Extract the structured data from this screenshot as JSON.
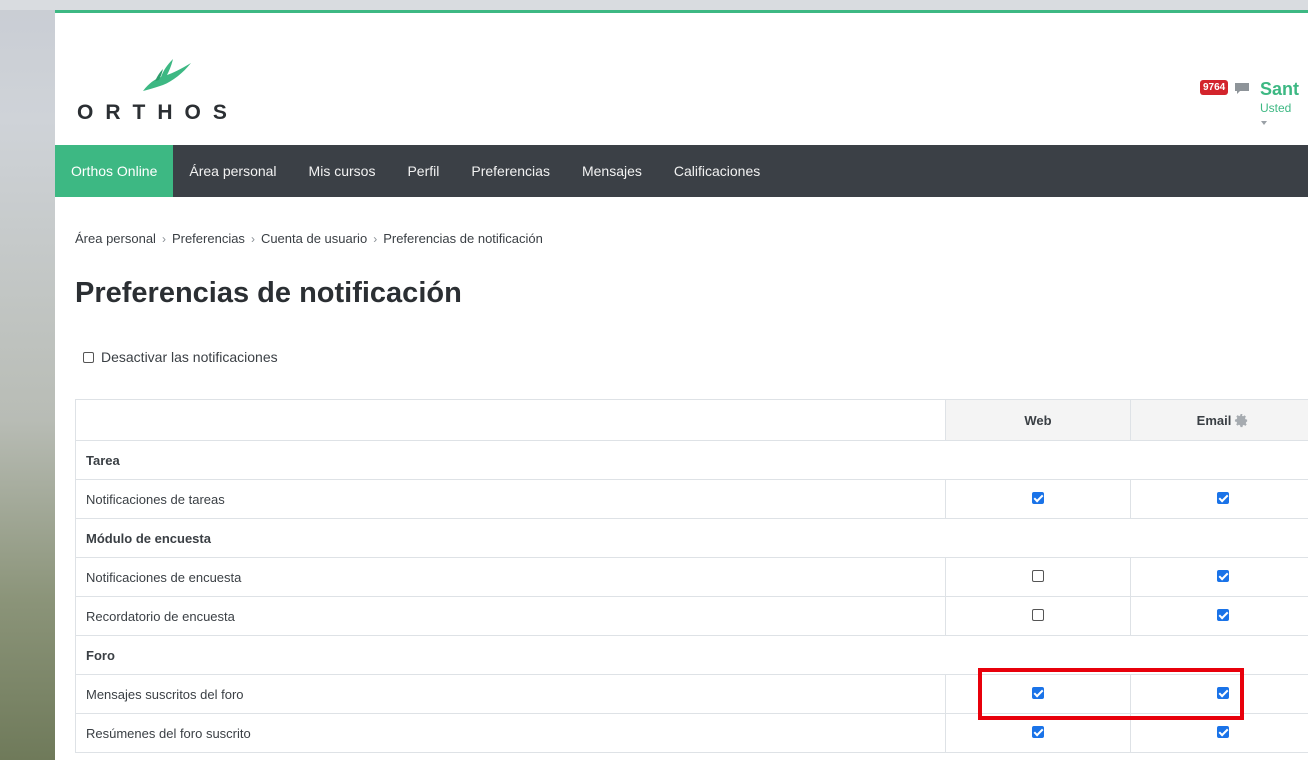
{
  "header": {
    "logo_text": "ORTHOS",
    "notification_count": "9764",
    "user_name": "Sant",
    "user_subtitle": "Usted"
  },
  "nav": {
    "items": [
      {
        "label": "Orthos Online",
        "active": true
      },
      {
        "label": "Área personal"
      },
      {
        "label": "Mis cursos"
      },
      {
        "label": "Perfil"
      },
      {
        "label": "Preferencias"
      },
      {
        "label": "Mensajes"
      },
      {
        "label": "Calificaciones"
      }
    ]
  },
  "breadcrumb": [
    "Área personal",
    "Preferencias",
    "Cuenta de usuario",
    "Preferencias de notificación"
  ],
  "page_title": "Preferencias de notificación",
  "disable_notifications": {
    "label": "Desactivar las notificaciones",
    "checked": false
  },
  "table": {
    "columns": [
      "",
      "Web",
      "Email"
    ],
    "rows": [
      {
        "type": "group",
        "label": "Tarea"
      },
      {
        "type": "item",
        "label": "Notificaciones de tareas",
        "web": true,
        "email": true
      },
      {
        "type": "group",
        "label": "Módulo de encuesta"
      },
      {
        "type": "item",
        "label": "Notificaciones de encuesta",
        "web": false,
        "email": true
      },
      {
        "type": "item",
        "label": "Recordatorio de encuesta",
        "web": false,
        "email": true
      },
      {
        "type": "group",
        "label": "Foro"
      },
      {
        "type": "item",
        "label": "Mensajes suscritos del foro",
        "web": true,
        "email": true
      },
      {
        "type": "item",
        "label": "Resúmenes del foro suscrito",
        "web": true,
        "email": true
      }
    ]
  },
  "colors": {
    "accent": "#3db883",
    "nav_bg": "#3b4046",
    "highlight": "#e8000b",
    "checkbox": "#1a73e8"
  },
  "icons": [
    "bird-logo-icon",
    "chat-icon",
    "gear-icon",
    "chevron-right-icon"
  ]
}
